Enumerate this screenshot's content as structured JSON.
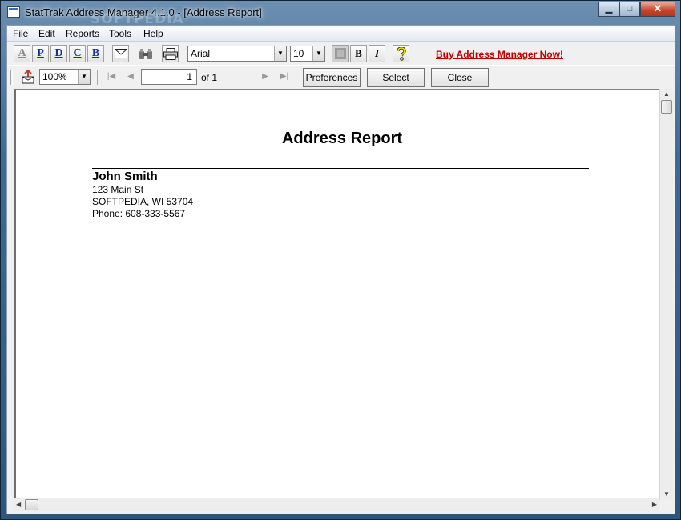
{
  "window": {
    "title": "StatTrak Address Manager 4.1.0 - [Address Report]",
    "watermark": "SOFTPEDIA",
    "controls": {
      "minimize": "▁",
      "maximize": "□",
      "close": "✕"
    }
  },
  "menu": [
    "File",
    "Edit",
    "Reports",
    "Tools",
    "Help"
  ],
  "toolbar": {
    "letter_buttons": [
      "A",
      "P",
      "D",
      "C",
      "B"
    ],
    "font": "Arial",
    "font_size": "10",
    "bold": "B",
    "italic": "I",
    "buy_link": "Buy Address Manager Now!"
  },
  "preview_bar": {
    "zoom": "100%",
    "page": "1",
    "of_text": "of 1",
    "preferences": "Preferences",
    "select": "Select",
    "close": "Close"
  },
  "report": {
    "title": "Address Report",
    "name": "John Smith",
    "street": "123 Main St",
    "city_state_zip": "SOFTPEDIA, WI 53704",
    "phone": "Phone: 608-333-5567"
  }
}
